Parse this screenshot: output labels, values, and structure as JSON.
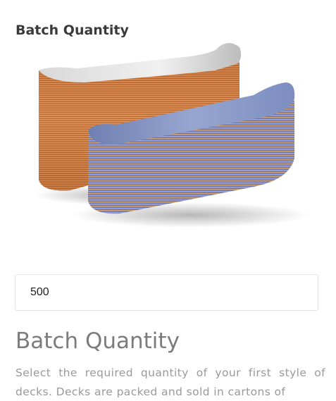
{
  "section": {
    "label": "Batch Quantity"
  },
  "product_image": {
    "alt": "Two stacks of skateboard decks"
  },
  "quantity_input": {
    "value": "500"
  },
  "info": {
    "heading": "Batch Quantity",
    "description": "Select the required quantity of your first style of decks. Decks are packed and sold in cartons of"
  },
  "colors": {
    "label_text": "#3a3a3a",
    "heading_text": "#7c7c7c",
    "body_text": "#9a9a9a",
    "input_border": "#e3e3e3",
    "deck_stack_rear": "#c8783f",
    "deck_stack_front": "#8a93bd"
  }
}
